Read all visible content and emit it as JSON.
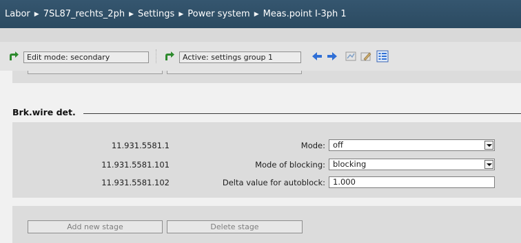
{
  "breadcrumb": [
    "Labor",
    "7SL87_rechts_2ph",
    "Settings",
    "Power system",
    "Meas.point I-3ph 1"
  ],
  "toolbar": {
    "edit_mode": "Edit mode: secondary",
    "active_group": "Active: settings group 1"
  },
  "section": {
    "title": "Brk.wire det."
  },
  "rows": [
    {
      "id": "11.931.5581.1",
      "label": "Mode:",
      "value": "off",
      "type": "dropdown"
    },
    {
      "id": "11.931.5581.101",
      "label": "Mode of blocking:",
      "value": "blocking",
      "type": "dropdown"
    },
    {
      "id": "11.931.5581.102",
      "label": "Delta value for autoblock:",
      "value": "1.000",
      "type": "text"
    }
  ],
  "buttons": {
    "add_stage": "Add new stage",
    "delete_stage": "Delete stage"
  },
  "colors": {
    "breadcrumb_bg": "#2f4f67",
    "panel_gray": "#dcdcdc",
    "arrow_green": "#2d8a2d",
    "nav_blue": "#2f6fd6"
  }
}
